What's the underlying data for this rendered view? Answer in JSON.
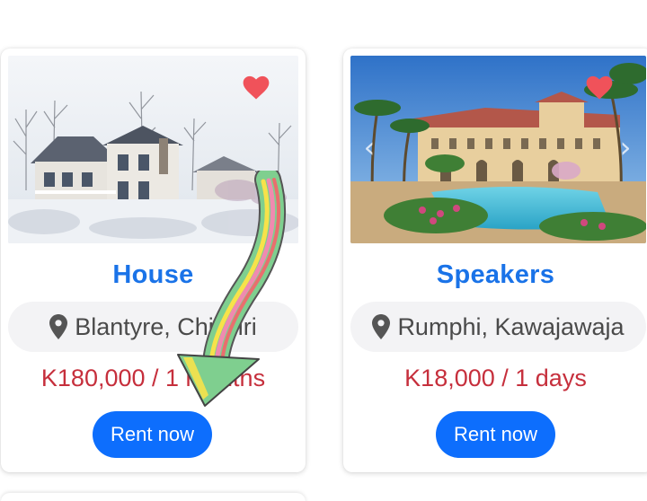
{
  "listings": [
    {
      "title": "House",
      "location": "Blantyre, Chitsiiri",
      "price": "K180,000 / 1 months",
      "button_label": "Rent now",
      "favorite": true,
      "image": "snowy-house-photo"
    },
    {
      "title": "Speakers",
      "location": "Rumphi, Kawajawaja",
      "price": "K18,000 / 1 days",
      "button_label": "Rent now",
      "favorite": true,
      "image": "villa-pool-photo"
    }
  ],
  "icons": {
    "favorite": "heart-icon",
    "location": "map-pin-icon",
    "prev": "chevron-left-icon",
    "next": "chevron-right-icon"
  },
  "colors": {
    "title": "#1a73e8",
    "price": "#c62f3c",
    "button": "#0d6efd",
    "heart": "#f0525a",
    "pill_bg": "#f3f3f5"
  }
}
